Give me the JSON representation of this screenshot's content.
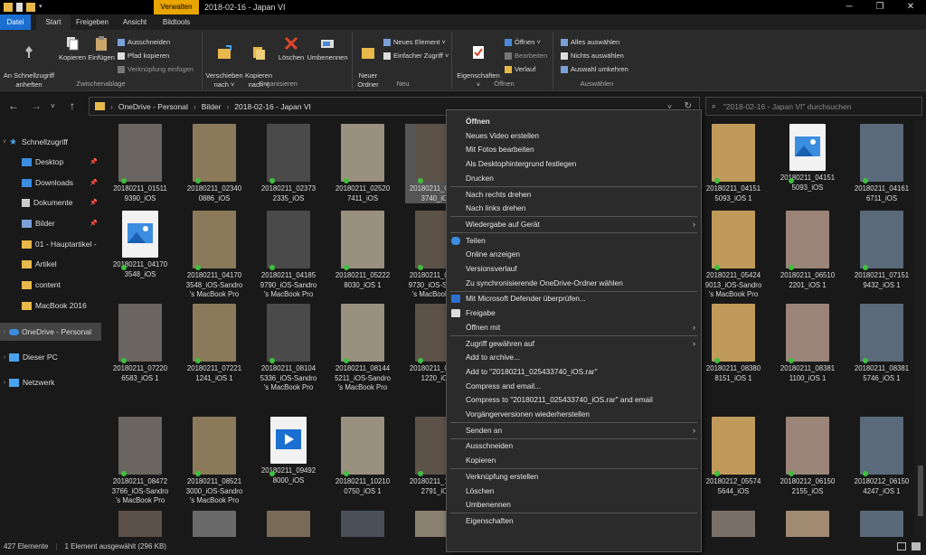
{
  "window": {
    "title": "2018-02-16 - Japan VI",
    "context_tab": "Verwalten",
    "min_glyph": "─",
    "max_glyph": "❐",
    "close_glyph": "✕"
  },
  "tabs": [
    "Datei",
    "Start",
    "Freigeben",
    "Ansicht",
    "Bildtools"
  ],
  "ribbon": {
    "clipboard": {
      "pin_label": "An Schnellzugriff\nanheften",
      "copy_label": "Kopieren",
      "paste_label": "Einfügen",
      "cut_label": "Ausschneiden",
      "copy_path_label": "Pfad kopieren",
      "paste_shortcut_label": "Verknüpfung einfügen",
      "group_label": "Zwischenablage"
    },
    "organize": {
      "move_label": "Verschieben\nnach ˅",
      "copyto_label": "Kopieren\nnach ˅",
      "delete_label": "Löschen",
      "rename_label": "Umbenennen",
      "group_label": "Organisieren"
    },
    "new": {
      "folder_label": "Neuer\nOrdner",
      "new_item_label": "Neues Element ˅",
      "easy_access_label": "Einfacher Zugriff ˅",
      "group_label": "Neu"
    },
    "open": {
      "properties_label": "Eigenschaften\n˅",
      "open_label": "Öffnen ˅",
      "edit_label": "Bearbeiten",
      "history_label": "Verlauf",
      "group_label": "Öffnen"
    },
    "select": {
      "select_all_label": "Alles auswählen",
      "select_none_label": "Nichts auswählen",
      "invert_label": "Auswahl umkehren",
      "group_label": "Auswählen"
    }
  },
  "addressbar": {
    "crumbs": [
      "OneDrive - Personal",
      "Bilder",
      "2018-02-16 - Japan VI"
    ],
    "search_placeholder": "\"2018-02-16 - Japan VI\" durchsuchen"
  },
  "sidebar": {
    "items": [
      {
        "label": "Schnellzugriff",
        "pinned": false
      },
      {
        "label": "Desktop",
        "pinned": true
      },
      {
        "label": "Downloads",
        "pinned": true
      },
      {
        "label": "Dokumente",
        "pinned": true
      },
      {
        "label": "Bilder",
        "pinned": true
      },
      {
        "label": "01 - Hauptartikel -",
        "pinned": false
      },
      {
        "label": "Artikel",
        "pinned": false
      },
      {
        "label": "content",
        "pinned": false
      },
      {
        "label": "MacBook 2016",
        "pinned": false
      },
      {
        "label": "OneDrive - Personal",
        "pinned": false
      },
      {
        "label": "Dieser PC",
        "pinned": false
      },
      {
        "label": "Netzwerk",
        "pinned": false
      }
    ]
  },
  "files": [
    [
      "20180211_01511\n9390_iOS",
      "20180211_02340\n0886_iOS",
      "20180211_02373\n2335_iOS",
      "20180211_02520\n7411_iOS",
      "20180211_02543\n3740_iOS",
      "",
      "",
      "",
      "20180211_04151\n5093_iOS 1",
      "20180211_04151\n5093_iOS",
      "20180211_04161\n6711_iOS"
    ],
    [
      "20180211_04170\n3548_iOS",
      "20180211_04170\n3548_iOS-Sandro\n's MacBook Pro",
      "20180211_04185\n9790_iOS-Sandro\n's MacBook Pro",
      "20180211_05222\n8030_iOS 1",
      "20180211_05223\n9730_iOS-Sandro\n's MacBook Pro",
      "",
      "",
      "",
      "20180211_05424\n9013_iOS-Sandro\n's MacBook Pro",
      "20180211_06510\n2201_iOS 1",
      "20180211_07151\n9432_iOS 1"
    ],
    [
      "20180211_07220\n6583_iOS 1",
      "20180211_07221\n1241_iOS 1",
      "20180211_08104\n5336_iOS-Sandro\n's MacBook Pro",
      "20180211_08144\n5211_iOS-Sandro\n's MacBook Pro",
      "20180211_08150\n1220_iOS",
      "",
      "",
      "",
      "20180211_08380\n8151_iOS 1",
      "20180211_08381\n1100_iOS 1",
      "20180211_08381\n5746_iOS 1"
    ],
    [
      "20180211_08472\n3766_iOS-Sandro\n's MacBook Pro",
      "20180211_08521\n3000_iOS-Sandro\n's MacBook Pro",
      "20180211_09492\n8000_iOS",
      "20180211_10210\n0750_iOS 1",
      "20180211_10212\n2791_iOS",
      "",
      "",
      "",
      "20180212_05574\n5644_iOS",
      "20180212_06150\n2155_iOS",
      "20180212_06150\n4247_iOS 1"
    ]
  ],
  "context_menu": [
    {
      "label": "Öffnen",
      "bold": true
    },
    {
      "label": "Neues Video erstellen"
    },
    {
      "label": "Mit Fotos bearbeiten"
    },
    {
      "label": "Als Desktophintergrund festlegen"
    },
    {
      "label": "Drucken"
    },
    {
      "sep": true
    },
    {
      "label": "Nach rechts drehen"
    },
    {
      "label": "Nach links drehen"
    },
    {
      "sep": true
    },
    {
      "label": "Wiedergabe auf Gerät",
      "sub": true
    },
    {
      "sep": true
    },
    {
      "label": "Teilen",
      "icon": "onedrive-icon"
    },
    {
      "label": "Online anzeigen"
    },
    {
      "label": "Versionsverlauf"
    },
    {
      "label": "Zu synchronisierende OneDrive-Ordner wählen"
    },
    {
      "sep": true
    },
    {
      "label": "Mit Microsoft Defender überprüfen...",
      "icon": "defender-icon"
    },
    {
      "label": "Freigabe",
      "icon": "share-icon"
    },
    {
      "label": "Öffnen mit",
      "sub": true
    },
    {
      "sep": true
    },
    {
      "label": "Zugriff gewähren auf",
      "sub": true
    },
    {
      "label": "Add to archive..."
    },
    {
      "label": "Add to \"20180211_025433740_iOS.rar\""
    },
    {
      "label": "Compress and email..."
    },
    {
      "label": "Compress to \"20180211_025433740_iOS.rar\" and email"
    },
    {
      "label": "Vorgängerversionen wiederherstellen"
    },
    {
      "sep": true
    },
    {
      "label": "Senden an",
      "sub": true
    },
    {
      "sep": true
    },
    {
      "label": "Ausschneiden"
    },
    {
      "label": "Kopieren"
    },
    {
      "sep": true
    },
    {
      "label": "Verknüpfung erstellen"
    },
    {
      "label": "Löschen"
    },
    {
      "label": "Umbenennen"
    },
    {
      "sep": true
    },
    {
      "label": "Eigenschaften"
    }
  ],
  "status": {
    "count": "427 Elemente",
    "selection": "1 Element ausgewählt (296 KB)"
  },
  "colors": {
    "accent": "#1a6fd1",
    "context_tab": "#e8a500",
    "sync_green": "#3fbf3f"
  }
}
